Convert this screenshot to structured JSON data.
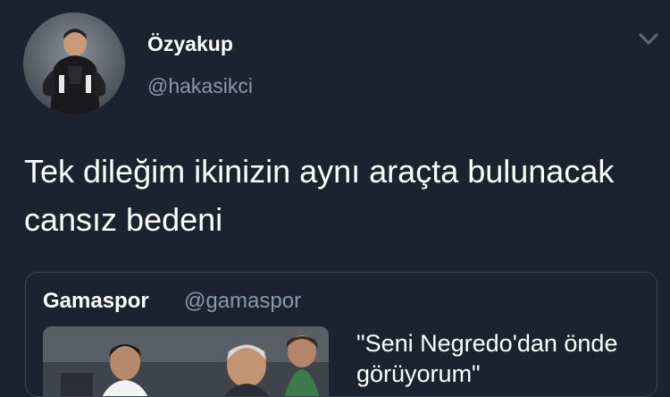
{
  "tweet": {
    "display_name": "Özyakup",
    "handle": "@hakasikci",
    "text": "Tek dileğim ikinizin aynı araçta bulunacak cansız bedeni",
    "menu_icon": "chevron-down-icon",
    "avatar_icon": "avatar"
  },
  "quoted_tweet": {
    "display_name": "Gamaspor",
    "handle": "@gamaspor",
    "text": "\"Seni Negredo'dan önde görüyorum\""
  },
  "colors": {
    "background": "#1b2230",
    "primary_text": "#ffffff",
    "secondary_text": "#8b98a7",
    "border": "#3a4452"
  }
}
